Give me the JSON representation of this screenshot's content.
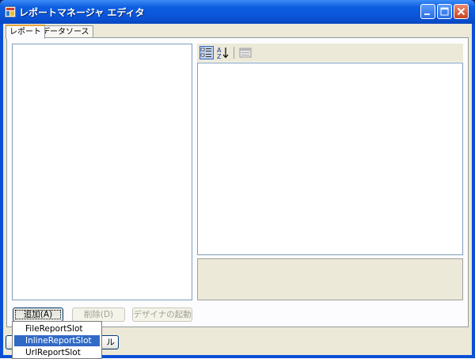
{
  "window": {
    "title": "レポートマネージャ エディタ",
    "controls": {
      "minimize": "minimize",
      "maximize": "maximize",
      "close": "close"
    }
  },
  "tabs": [
    {
      "label": "レポート",
      "active": true
    },
    {
      "label": "データソース",
      "active": false
    }
  ],
  "property_grid": {
    "toolbar": [
      {
        "icon": "categorized-view-icon",
        "active": true
      },
      {
        "icon": "alphabetical-sort-icon",
        "active": false
      },
      {
        "icon": "property-pages-icon",
        "active": false
      }
    ]
  },
  "buttons": {
    "add": "追加(A)",
    "delete": "削除(D)",
    "launch_designer": "デザイナの起動",
    "bottom_left": "",
    "bottom_cancel_fragment": "ル"
  },
  "dropdown_menu": {
    "items": [
      {
        "label": "FileReportSlot",
        "selected": false
      },
      {
        "label": "InlineReportSlot",
        "selected": true
      },
      {
        "label": "UrlReportSlot",
        "selected": false
      }
    ]
  },
  "colors": {
    "titlebar": "#0a54d8",
    "client": "#ece9d8",
    "selection": "#316ac5",
    "tab_highlight": "#e6a33b"
  }
}
